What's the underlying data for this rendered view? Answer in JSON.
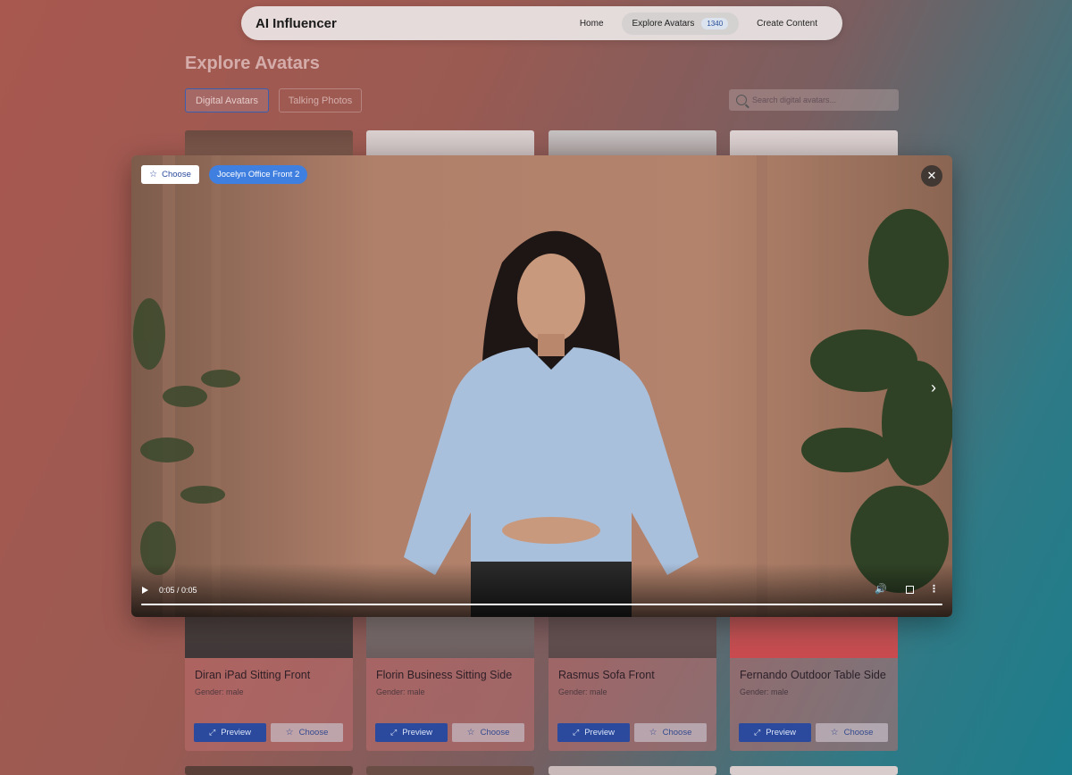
{
  "nav": {
    "brand": "AI Influencer",
    "links": [
      {
        "label": "Home"
      },
      {
        "label": "Explore Avatars",
        "badge": "1340"
      },
      {
        "label": "Create Content"
      }
    ]
  },
  "page": {
    "title": "Explore Avatars",
    "tabs": [
      "Digital Avatars",
      "Talking Photos"
    ],
    "active_tab": "Digital Avatars",
    "search_placeholder": "Search digital avatars..."
  },
  "cards": [
    {
      "name": "Diran iPad Sitting Front",
      "gender": "Gender: male"
    },
    {
      "name": "Florin Business Sitting Side",
      "gender": "Gender: male"
    },
    {
      "name": "Rasmus Sofa Front",
      "gender": "Gender: male"
    },
    {
      "name": "Fernando Outdoor Table Side",
      "gender": "Gender: male"
    }
  ],
  "card_buttons": {
    "preview": "Preview",
    "choose": "Choose"
  },
  "modal": {
    "choose_label": "Choose",
    "avatar_tag": "Jocelyn Office Front 2",
    "time": "0:05 / 0:05",
    "progress": 1.0
  },
  "colors": {
    "accent": "#3f7fe0",
    "primary_button": "#2b4a9e"
  },
  "icons": [
    "star-icon",
    "close-icon",
    "chevron-right-icon",
    "play-icon",
    "volume-icon",
    "fullscreen-icon",
    "more-vert-icon",
    "expand-icon",
    "search-icon"
  ]
}
